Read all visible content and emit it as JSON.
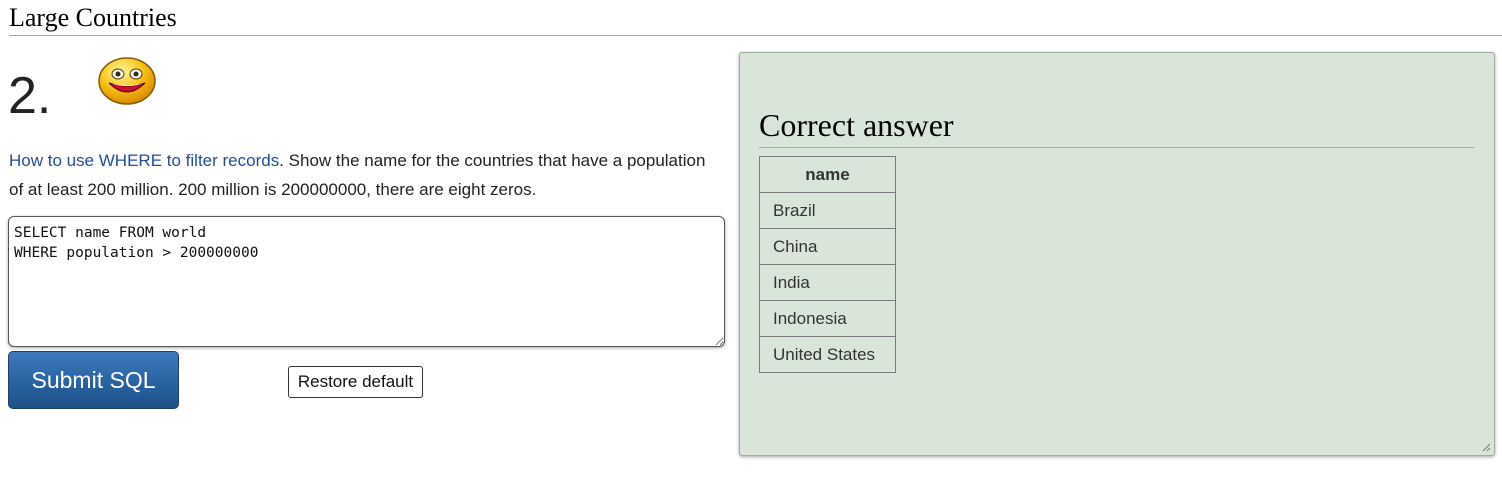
{
  "page": {
    "title": "Large Countries"
  },
  "question": {
    "number": "2.",
    "smiley_icon": "smiley-face-icon",
    "link_text": "How to use WHERE to filter records",
    "text": ". Show the name for the countries that have a population of at least 200 million. 200 million is 200000000, there are eight zeros."
  },
  "editor": {
    "value": "SELECT name FROM world\nWHERE population > 200000000"
  },
  "buttons": {
    "submit_label": "Submit SQL",
    "restore_label": "Restore default"
  },
  "answer": {
    "title": "Correct answer",
    "columns": [
      "name"
    ],
    "rows": [
      "Brazil",
      "China",
      "India",
      "Indonesia",
      "United States"
    ]
  },
  "colors": {
    "link": "#1f4e99",
    "submit_button": "#2a64a3",
    "answer_panel_bg": "#dae5da"
  }
}
